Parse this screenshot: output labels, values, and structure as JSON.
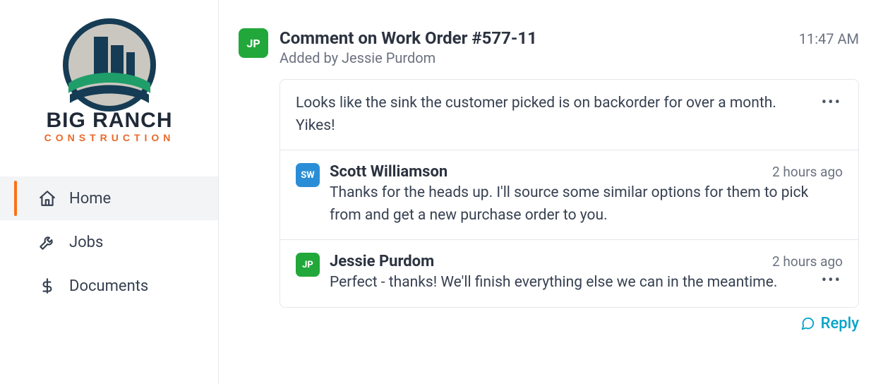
{
  "brand": {
    "name": "BIG RANCH",
    "sub": "CONSTRUCTION"
  },
  "sidebar": {
    "items": [
      {
        "label": "Home",
        "icon": "home-icon",
        "active": true
      },
      {
        "label": "Jobs",
        "icon": "wrench-icon",
        "active": false
      },
      {
        "label": "Documents",
        "icon": "dollar-icon",
        "active": false
      }
    ]
  },
  "feed": {
    "title": "Comment on Work Order #577-11",
    "added_by_prefix": "Added by ",
    "added_by_name": "Jessie Purdom",
    "timestamp": "11:47 AM",
    "author_avatar": {
      "initials": "JP",
      "color": "green"
    },
    "original": {
      "text": "Looks like the sink the customer picked is on backorder for over a month. Yikes!"
    },
    "replies": [
      {
        "avatar": {
          "initials": "SW",
          "color": "blue"
        },
        "name": "Scott Williamson",
        "time": "2 hours ago",
        "text": "Thanks for the heads up. I'll source some similar options for them to pick from and get a new purchase order to you.",
        "has_more": false
      },
      {
        "avatar": {
          "initials": "JP",
          "color": "green"
        },
        "name": "Jessie Purdom",
        "time": "2 hours ago",
        "text": "Perfect - thanks! We'll finish everything else we can in the meantime.",
        "has_more": true
      }
    ],
    "reply_label": "Reply"
  }
}
